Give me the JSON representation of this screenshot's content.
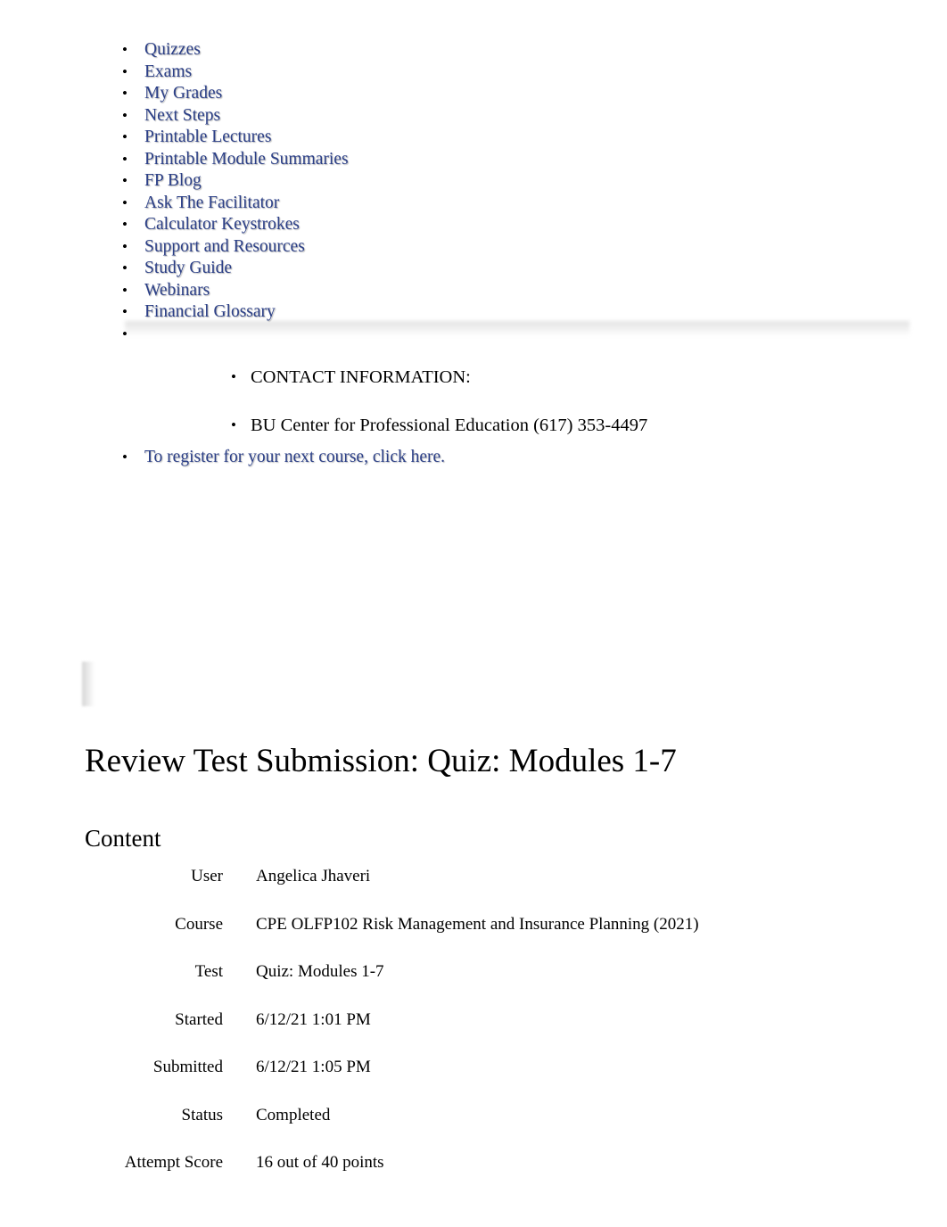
{
  "nav": {
    "items": [
      {
        "label": "Quizzes"
      },
      {
        "label": "Exams"
      },
      {
        "label": "My Grades"
      },
      {
        "label": "Next Steps"
      },
      {
        "label": "Printable Lectures"
      },
      {
        "label": "Printable Module Summaries"
      },
      {
        "label": "FP Blog"
      },
      {
        "label": "Ask The Facilitator"
      },
      {
        "label": "Calculator Keystrokes"
      },
      {
        "label": "Support and Resources"
      },
      {
        "label": "Study Guide"
      },
      {
        "label": "Webinars"
      },
      {
        "label": "Financial Glossary"
      }
    ]
  },
  "contact": {
    "heading": "CONTACT INFORMATION:",
    "detail": "BU Center for Professional Education (617) 353-4497",
    "register_text": "To register for your next course, click here."
  },
  "document": {
    "title": "Review Test Submission: Quiz: Modules 1-7",
    "section_heading": "Content",
    "fields": [
      {
        "label": "User",
        "value": "Angelica Jhaveri"
      },
      {
        "label": "Course",
        "value": "CPE OLFP102 Risk Management and Insurance Planning (2021)"
      },
      {
        "label": "Test",
        "value": "Quiz: Modules 1-7"
      },
      {
        "label": "Started",
        "value": "6/12/21 1:01 PM"
      },
      {
        "label": "Submitted",
        "value": "6/12/21 1:05 PM"
      },
      {
        "label": "Status",
        "value": "Completed"
      },
      {
        "label": "Attempt Score",
        "value": "16 out of 40 points"
      }
    ]
  },
  "colors": {
    "link": "#2b3f87",
    "text": "#000000",
    "background": "#ffffff"
  }
}
